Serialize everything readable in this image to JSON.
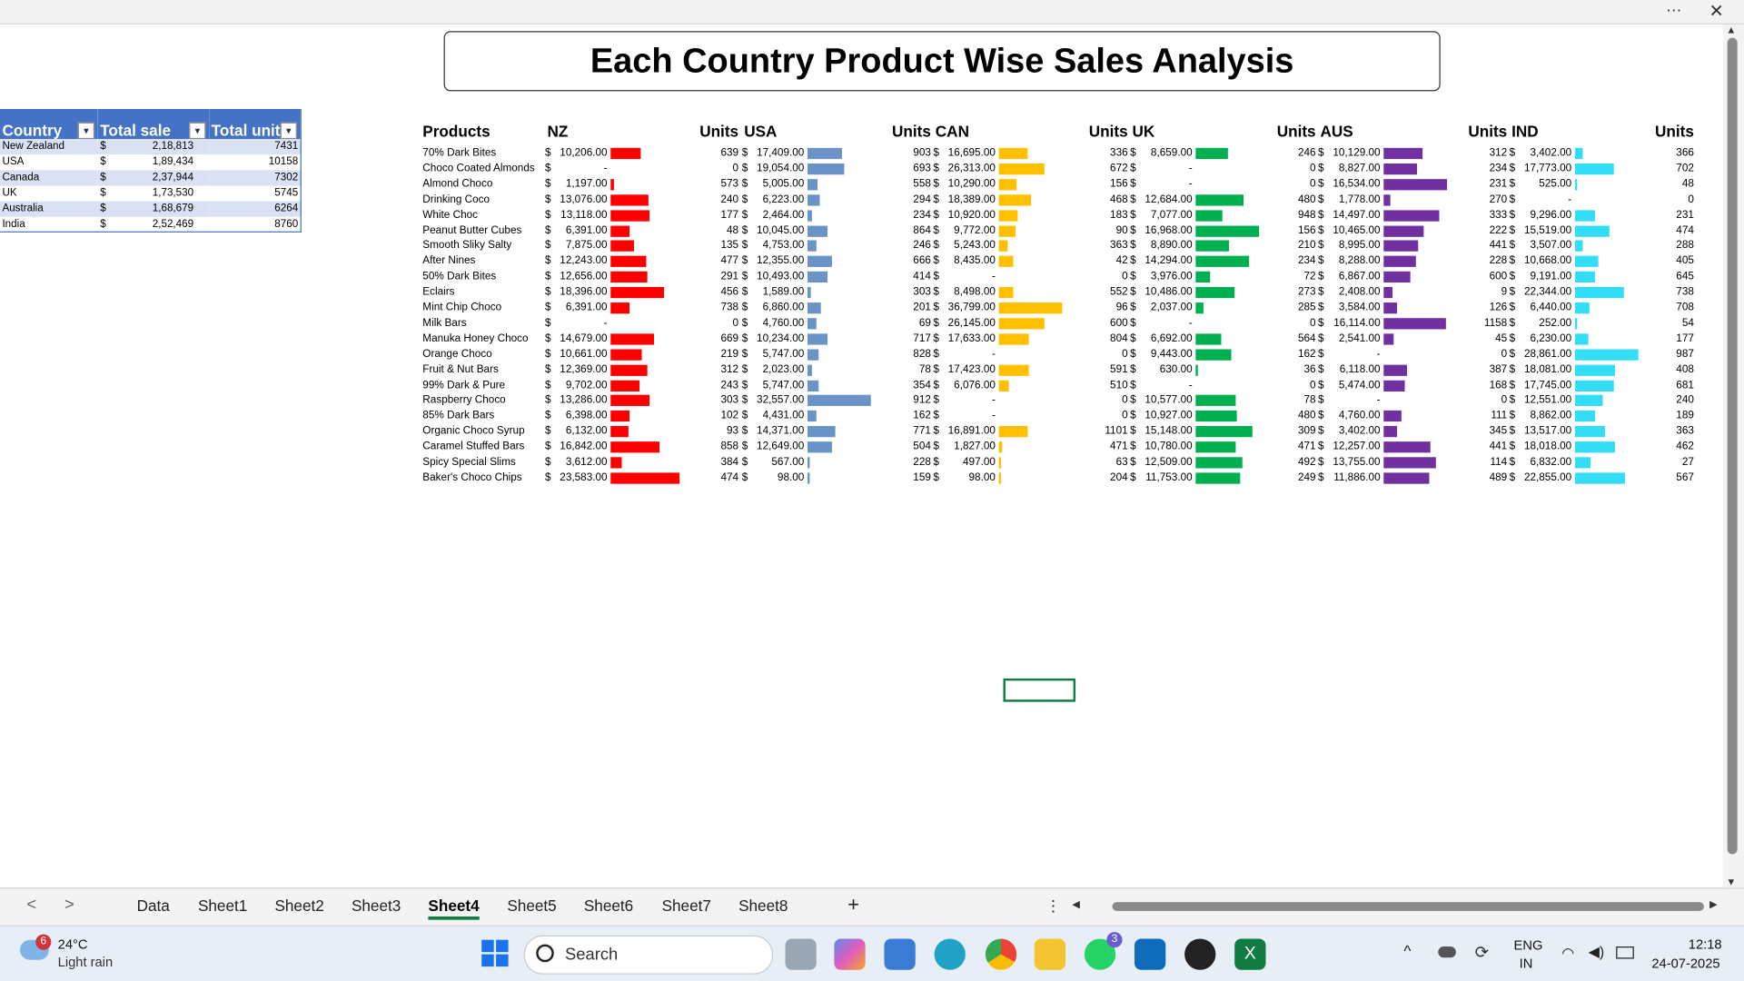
{
  "window": {
    "more": "⋯",
    "close": "✕"
  },
  "title": "Each Country Product Wise Sales Analysis",
  "pivot": {
    "headers": [
      "Country",
      "Total sale",
      "Total unit"
    ],
    "rows": [
      {
        "country": "New Zealand",
        "cur": "$",
        "sale": "2,18,813",
        "unit": "7431"
      },
      {
        "country": "USA",
        "cur": "$",
        "sale": "1,89,434",
        "unit": "10158"
      },
      {
        "country": "Canada",
        "cur": "$",
        "sale": "2,37,944",
        "unit": "7302"
      },
      {
        "country": "UK",
        "cur": "$",
        "sale": "1,73,530",
        "unit": "5745"
      },
      {
        "country": "Australia",
        "cur": "$",
        "sale": "1,68,679",
        "unit": "6264"
      },
      {
        "country": "India",
        "cur": "$",
        "sale": "2,52,469",
        "unit": "8760"
      }
    ]
  },
  "dashboard": {
    "products_header": "Products",
    "units_header": "Units",
    "products": [
      "70% Dark Bites",
      "Choco Coated Almonds",
      "Almond Choco",
      "Drinking Coco",
      "White Choc",
      "Peanut Butter Cubes",
      "Smooth Sliky Salty",
      "After Nines",
      "50% Dark Bites",
      "Eclairs",
      "Mint Chip Choco",
      "Milk Bars",
      "Manuka Honey Choco",
      "Orange Choco",
      "Fruit & Nut Bars",
      "99% Dark & Pure",
      "Raspberry Choco",
      "85% Dark Bars",
      "Organic Choco Syrup",
      "Caramel Stuffed Bars",
      "Spicy Special Slims",
      "Baker's Choco Chips"
    ],
    "countries": [
      {
        "name": "NZ",
        "color": "#ff0000",
        "sales": [
          "10,206.00",
          "-",
          "1,197.00",
          "13,076.00",
          "13,118.00",
          "6,391.00",
          "7,875.00",
          "12,243.00",
          "12,656.00",
          "18,396.00",
          "6,391.00",
          "-",
          "14,679.00",
          "10,661.00",
          "12,369.00",
          "9,702.00",
          "13,286.00",
          "6,398.00",
          "6,132.00",
          "16,842.00",
          "3,612.00",
          "23,583.00"
        ],
        "bars": [
          10206,
          0,
          1197,
          13076,
          13118,
          6391,
          7875,
          12243,
          12656,
          18396,
          6391,
          0,
          14679,
          10661,
          12369,
          9702,
          13286,
          6398,
          6132,
          16842,
          3612,
          23583
        ],
        "units": [
          "639",
          "0",
          "573",
          "240",
          "177",
          "48",
          "135",
          "477",
          "291",
          "456",
          "738",
          "0",
          "669",
          "219",
          "312",
          "243",
          "303",
          "102",
          "93",
          "858",
          "384",
          "474"
        ]
      },
      {
        "name": "USA",
        "color": "#6a93c8",
        "sales": [
          "17,409.00",
          "19,054.00",
          "5,005.00",
          "6,223.00",
          "2,464.00",
          "10,045.00",
          "4,753.00",
          "12,355.00",
          "10,493.00",
          "1,589.00",
          "6,860.00",
          "4,760.00",
          "10,234.00",
          "5,747.00",
          "2,023.00",
          "5,747.00",
          "32,557.00",
          "4,431.00",
          "14,371.00",
          "12,649.00",
          "567.00",
          "98.00"
        ],
        "bars": [
          17409,
          19054,
          5005,
          6223,
          2464,
          10045,
          4753,
          12355,
          10493,
          1589,
          6860,
          4760,
          10234,
          5747,
          2023,
          5747,
          32557,
          4431,
          14371,
          12649,
          567,
          98
        ],
        "units": [
          "903",
          "693",
          "558",
          "294",
          "234",
          "864",
          "246",
          "666",
          "414",
          "303",
          "201",
          "69",
          "717",
          "828",
          "78",
          "354",
          "912",
          "162",
          "771",
          "504",
          "228",
          "159"
        ]
      },
      {
        "name": "CAN",
        "color": "#ffc000",
        "sales": [
          "16,695.00",
          "26,313.00",
          "10,290.00",
          "18,389.00",
          "10,920.00",
          "9,772.00",
          "5,243.00",
          "8,435.00",
          "-",
          "8,498.00",
          "36,799.00",
          "26,145.00",
          "17,633.00",
          "-",
          "17,423.00",
          "6,076.00",
          "-",
          "-",
          "16,891.00",
          "1,827.00",
          "497.00",
          "98.00"
        ],
        "bars": [
          16695,
          26313,
          10290,
          18389,
          10920,
          9772,
          5243,
          8435,
          0,
          8498,
          36799,
          26145,
          17633,
          0,
          17423,
          6076,
          0,
          0,
          16891,
          1827,
          497,
          98
        ],
        "units": [
          "336",
          "672",
          "156",
          "468",
          "183",
          "90",
          "363",
          "42",
          "0",
          "552",
          "96",
          "600",
          "804",
          "0",
          "591",
          "510",
          "0",
          "0",
          "1101",
          "471",
          "63",
          "204"
        ]
      },
      {
        "name": "UK",
        "color": "#00b050",
        "sales": [
          "8,659.00",
          "-",
          "-",
          "12,684.00",
          "7,077.00",
          "16,968.00",
          "8,890.00",
          "14,294.00",
          "3,976.00",
          "10,486.00",
          "2,037.00",
          "-",
          "6,692.00",
          "9,443.00",
          "630.00",
          "-",
          "10,577.00",
          "10,927.00",
          "15,148.00",
          "10,780.00",
          "12,509.00",
          "11,753.00"
        ],
        "bars": [
          8659,
          0,
          0,
          12684,
          7077,
          16968,
          8890,
          14294,
          3976,
          10486,
          2037,
          0,
          6692,
          9443,
          630,
          0,
          10577,
          10927,
          15148,
          10780,
          12509,
          11753
        ],
        "units": [
          "246",
          "0",
          "0",
          "480",
          "948",
          "156",
          "210",
          "234",
          "72",
          "273",
          "285",
          "0",
          "564",
          "162",
          "36",
          "0",
          "78",
          "480",
          "309",
          "471",
          "492",
          "249"
        ]
      },
      {
        "name": "AUS",
        "color": "#7030a0",
        "sales": [
          "10,129.00",
          "8,827.00",
          "16,534.00",
          "1,778.00",
          "14,497.00",
          "10,465.00",
          "8,995.00",
          "8,288.00",
          "6,867.00",
          "2,408.00",
          "3,584.00",
          "16,114.00",
          "2,541.00",
          "-",
          "6,118.00",
          "5,474.00",
          "-",
          "4,760.00",
          "3,402.00",
          "12,257.00",
          "13,755.00",
          "11,886.00"
        ],
        "bars": [
          10129,
          8827,
          16534,
          1778,
          14497,
          10465,
          8995,
          8288,
          6867,
          2408,
          3584,
          16114,
          2541,
          0,
          6118,
          5474,
          0,
          4760,
          3402,
          12257,
          13755,
          11886
        ],
        "units": [
          "312",
          "234",
          "231",
          "270",
          "333",
          "222",
          "441",
          "228",
          "600",
          "9",
          "126",
          "1158",
          "45",
          "0",
          "387",
          "168",
          "0",
          "111",
          "345",
          "441",
          "114",
          "489"
        ]
      },
      {
        "name": "IND",
        "color": "#33ddf5",
        "sales": [
          "3,402.00",
          "17,773.00",
          "525.00",
          "-",
          "9,296.00",
          "15,519.00",
          "3,507.00",
          "10,668.00",
          "9,191.00",
          "22,344.00",
          "6,440.00",
          "252.00",
          "6,230.00",
          "28,861.00",
          "18,081.00",
          "17,745.00",
          "12,551.00",
          "8,862.00",
          "13,517.00",
          "18,018.00",
          "6,832.00",
          "22,855.00"
        ],
        "bars": [
          3402,
          17773,
          525,
          0,
          9296,
          15519,
          3507,
          10668,
          9191,
          22344,
          6440,
          252,
          6230,
          28861,
          18081,
          17745,
          12551,
          8862,
          13517,
          18018,
          6832,
          22855
        ],
        "units": [
          "366",
          "702",
          "48",
          "0",
          "231",
          "474",
          "288",
          "405",
          "645",
          "738",
          "708",
          "54",
          "177",
          "987",
          "408",
          "681",
          "240",
          "189",
          "363",
          "462",
          "27",
          "567"
        ]
      }
    ]
  },
  "tabs": {
    "items": [
      "Data",
      "Sheet1",
      "Sheet2",
      "Sheet3",
      "Sheet4",
      "Sheet5",
      "Sheet6",
      "Sheet7",
      "Sheet8"
    ],
    "active": "Sheet4",
    "add": "+",
    "prev": "<",
    "next": ">",
    "menu": "⋮"
  },
  "taskbar": {
    "weather_temp": "24°C",
    "weather_desc": "Light rain",
    "weather_badge": "6",
    "search": "Search",
    "whatsapp_badge": "3",
    "lang1": "ENG",
    "lang2": "IN",
    "time": "12:18",
    "date": "24-07-2025"
  }
}
